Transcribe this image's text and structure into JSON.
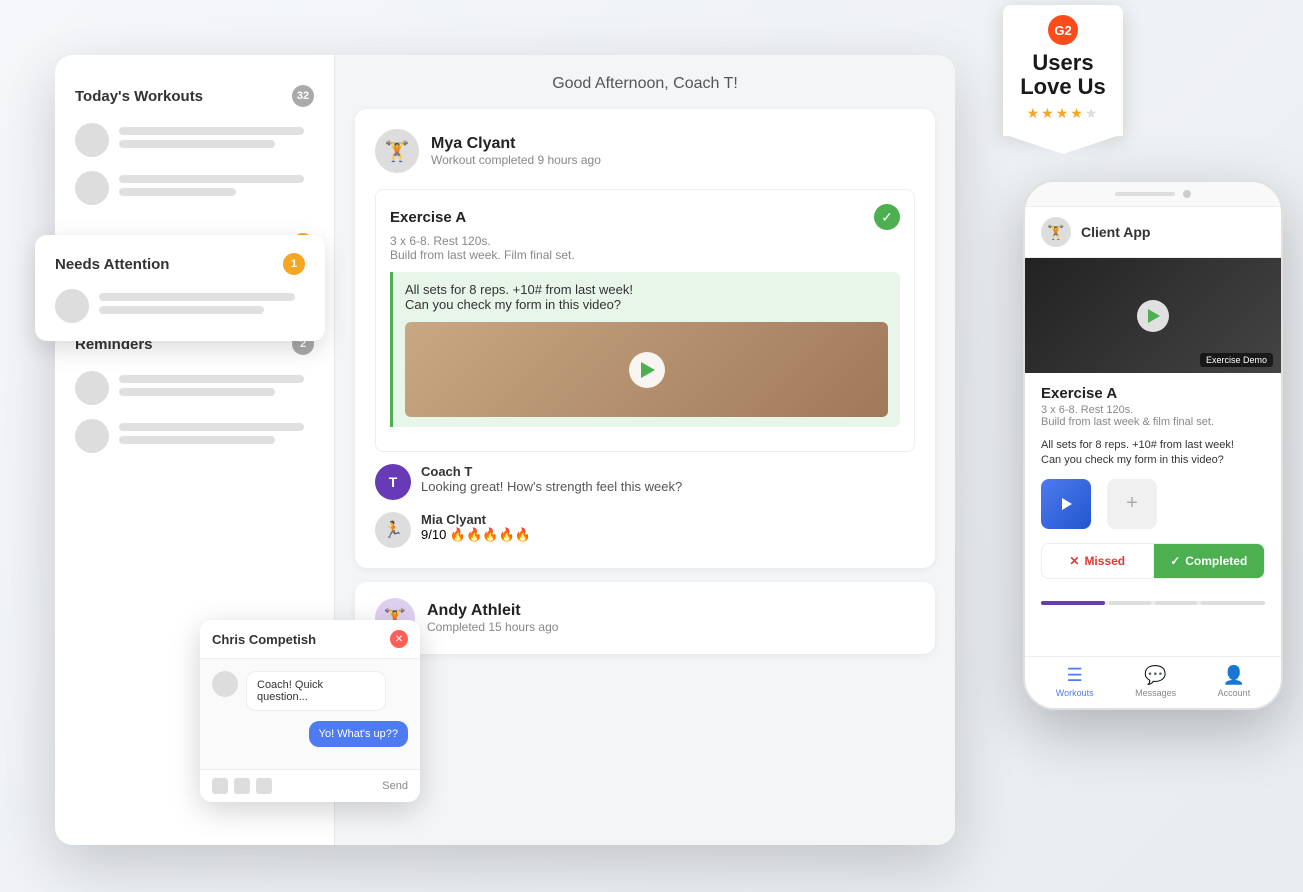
{
  "background": {
    "color": "#eef0f3"
  },
  "g2_badge": {
    "logo_text": "G2",
    "title_line1": "Users",
    "title_line2": "Love Us",
    "stars": "★★★★",
    "star_empty": "★"
  },
  "dashboard": {
    "sidebar": {
      "todays_workouts_title": "Today's Workouts",
      "todays_workouts_count": "32",
      "needs_attention_title": "Needs Attention",
      "needs_attention_count": "1",
      "reminders_title": "Reminders",
      "reminders_count": "2"
    },
    "greeting": "Good Afternoon, Coach T!",
    "client1": {
      "name": "Mya Clyant",
      "status": "Workout completed 9 hours ago",
      "exercise_name": "Exercise A",
      "exercise_detail": "3 x 6-8. Rest 120s.",
      "exercise_detail2": "Build from last week. Film final set.",
      "client_message_line1": "All sets for 8 reps. +10# from last week!",
      "client_message_line2": "Can you check my form in this video?",
      "coach_name": "Coach T",
      "coach_message": "Looking great! How's strength feel this week?",
      "feedback_name": "Mia Clyant",
      "feedback_rating": "9/10 🔥🔥🔥🔥🔥"
    },
    "client2": {
      "name": "Andy Athleit",
      "status": "Completed 15 hours ago"
    }
  },
  "chat_popup": {
    "user_name": "Chris Competish",
    "message1": "Coach! Quick question...",
    "message2": "Yo! What's up??",
    "send_label": "Send"
  },
  "needs_attention": {
    "title": "Needs Attention",
    "count": "1"
  },
  "phone": {
    "header_title": "Client App",
    "video_label": "Exercise Demo",
    "exercise_name": "Exercise A",
    "exercise_detail": "3 x 6-8. Rest 120s.",
    "exercise_detail2": "Build from last week & film final set.",
    "message_line1": "All sets for 8 reps. +10# from last week!",
    "message_line2": "Can you check my form in this video?",
    "missed_label": "Missed",
    "completed_label": "Completed",
    "nav_workouts": "Workouts",
    "nav_messages": "Messages",
    "nav_account": "Account"
  }
}
